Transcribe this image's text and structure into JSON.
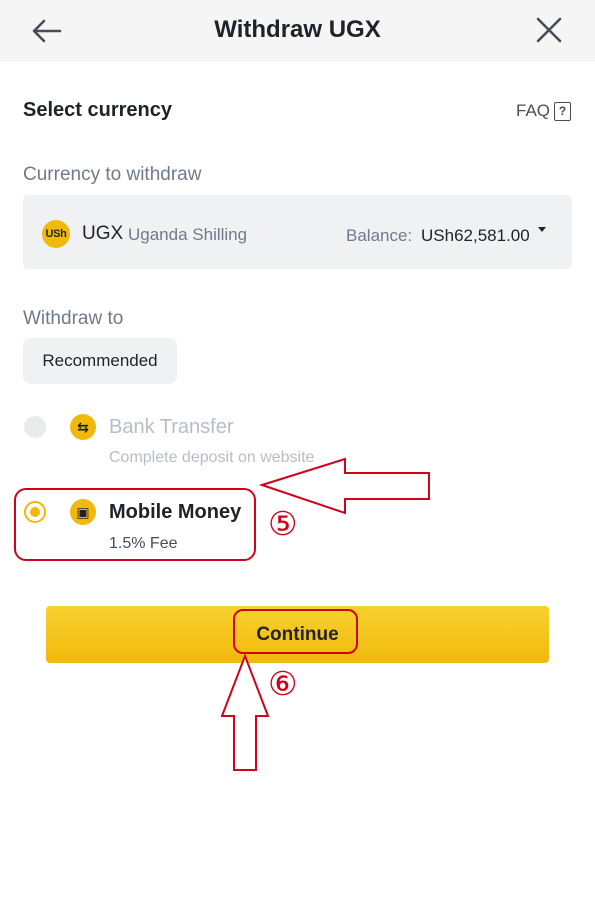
{
  "header": {
    "title": "Withdraw UGX"
  },
  "section": {
    "title": "Select currency",
    "faq_label": "FAQ",
    "faq_icon_glyph": "?"
  },
  "currency": {
    "label": "Currency to withdraw",
    "coin_glyph": "USh",
    "code": "UGX",
    "name": "Uganda Shilling",
    "balance_label": "Balance:",
    "balance_value": "USh62,581.00"
  },
  "withdraw_to": {
    "label": "Withdraw to",
    "chip": "Recommended",
    "methods": [
      {
        "title": "Bank Transfer",
        "subtitle": "Complete deposit on website",
        "state": "disabled",
        "icon": "bank-transfer-icon",
        "icon_glyph": "⇆"
      },
      {
        "title": "Mobile Money",
        "subtitle": "1.5% Fee",
        "state": "selected",
        "icon": "mobile-money-icon",
        "icon_glyph": "▣"
      }
    ]
  },
  "button": {
    "continue_label": "Continue"
  },
  "annotations": {
    "step5": "⑤",
    "step6": "⑥",
    "color": "#d0021b"
  },
  "colors": {
    "accent": "#f0b90b",
    "text": "#1e2329",
    "muted": "#707a8a"
  }
}
